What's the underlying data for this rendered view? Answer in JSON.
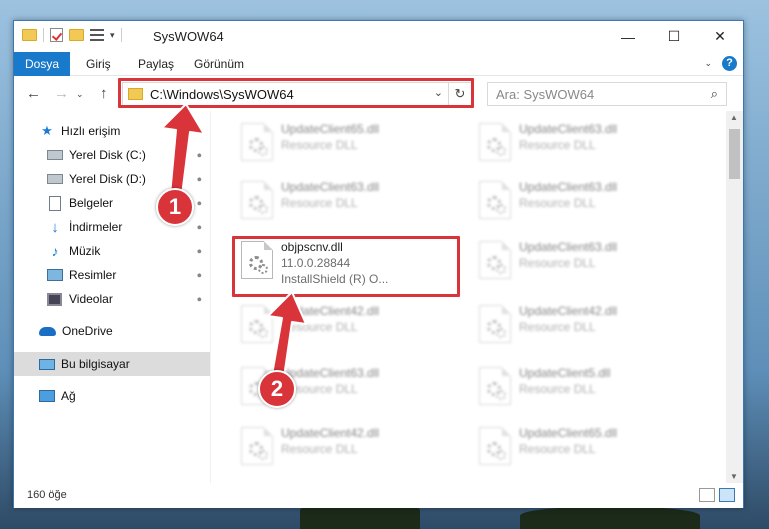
{
  "window": {
    "title": "SysWOW64",
    "controls": {
      "minimize": "—",
      "maximize": "☐",
      "close": "✕"
    }
  },
  "ribbon": {
    "tabs": [
      "Dosya",
      "Giriş",
      "Paylaş",
      "Görünüm"
    ]
  },
  "navigation": {
    "back": "←",
    "forward": "→",
    "up": "↑",
    "address": "C:\\Windows\\SysWOW64",
    "refresh": "↻",
    "search_placeholder": "Ara: SysWOW64"
  },
  "sidebar": {
    "items": [
      {
        "label": "Hızlı erişim",
        "icon": "star-icon",
        "pinned": false
      },
      {
        "label": "Yerel Disk (C:)",
        "icon": "drive-icon",
        "pinned": true
      },
      {
        "label": "Yerel Disk (D:)",
        "icon": "drive-icon",
        "pinned": true
      },
      {
        "label": "Belgeler",
        "icon": "documents-icon",
        "pinned": true
      },
      {
        "label": "İndirmeler",
        "icon": "download-icon",
        "pinned": true
      },
      {
        "label": "Müzik",
        "icon": "music-icon",
        "pinned": true
      },
      {
        "label": "Resimler",
        "icon": "pictures-icon",
        "pinned": true
      },
      {
        "label": "Videolar",
        "icon": "videos-icon",
        "pinned": true
      },
      {
        "label": "OneDrive",
        "icon": "cloud-icon",
        "pinned": false
      },
      {
        "label": "Bu bilgisayar",
        "icon": "computer-icon",
        "pinned": false,
        "selected": true
      },
      {
        "label": "Ağ",
        "icon": "network-icon",
        "pinned": false
      }
    ],
    "pin_glyph": "📌"
  },
  "files": [
    {
      "name": "UpdateClient65.dll",
      "desc": "Resource DLL",
      "blurred": true
    },
    {
      "name": "UpdateClient63.dll",
      "desc": "Resource DLL",
      "blurred": true
    },
    {
      "name": "UpdateClient63.dll",
      "desc": "Resource DLL",
      "blurred": true
    },
    {
      "name": "UpdateClient63.dll",
      "desc": "Resource DLL",
      "blurred": true
    },
    {
      "name": "objpscnv.dll",
      "desc": "11.0.0.28844",
      "desc2": "InstallShield (R) O...",
      "blurred": false
    },
    {
      "name": "UpdateClient63.dll",
      "desc": "Resource DLL",
      "blurred": true
    },
    {
      "name": "UpdateClient42.dll",
      "desc": "Resource DLL",
      "blurred": true
    },
    {
      "name": "UpdateClient42.dll",
      "desc": "Resource DLL",
      "blurred": true
    },
    {
      "name": "UpdateClient63.dll",
      "desc": "Resource DLL",
      "blurred": true
    },
    {
      "name": "UpdateClient5.dll",
      "desc": "Resource DLL",
      "blurred": true
    },
    {
      "name": "UpdateClient42.dll",
      "desc": "Resource DLL",
      "blurred": true
    },
    {
      "name": "UpdateClient65.dll",
      "desc": "Resource DLL",
      "blurred": true
    }
  ],
  "status": {
    "count": "160 öğe"
  },
  "annotations": {
    "step1": "1",
    "step2": "2",
    "color": "#d9343a"
  }
}
